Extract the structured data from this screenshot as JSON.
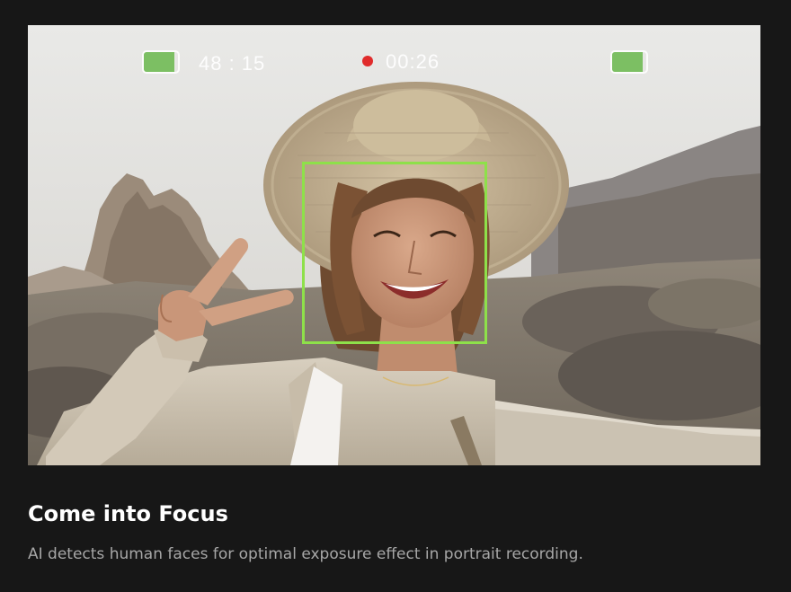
{
  "hud": {
    "recording_time_remaining": "48 : 15",
    "recording_elapsed": "00:26",
    "battery_left_level": 0.9,
    "battery_right_level": 0.9,
    "recording_indicator_color": "#e02b2b",
    "battery_color": "#7cbf63",
    "face_box_color": "#8ee04a"
  },
  "caption": {
    "title": "Come into Focus",
    "description": "AI detects human faces for optimal exposure effect in portrait recording."
  },
  "colors": {
    "background": "#171717",
    "title": "#ffffff",
    "description": "#a7a7a7"
  }
}
